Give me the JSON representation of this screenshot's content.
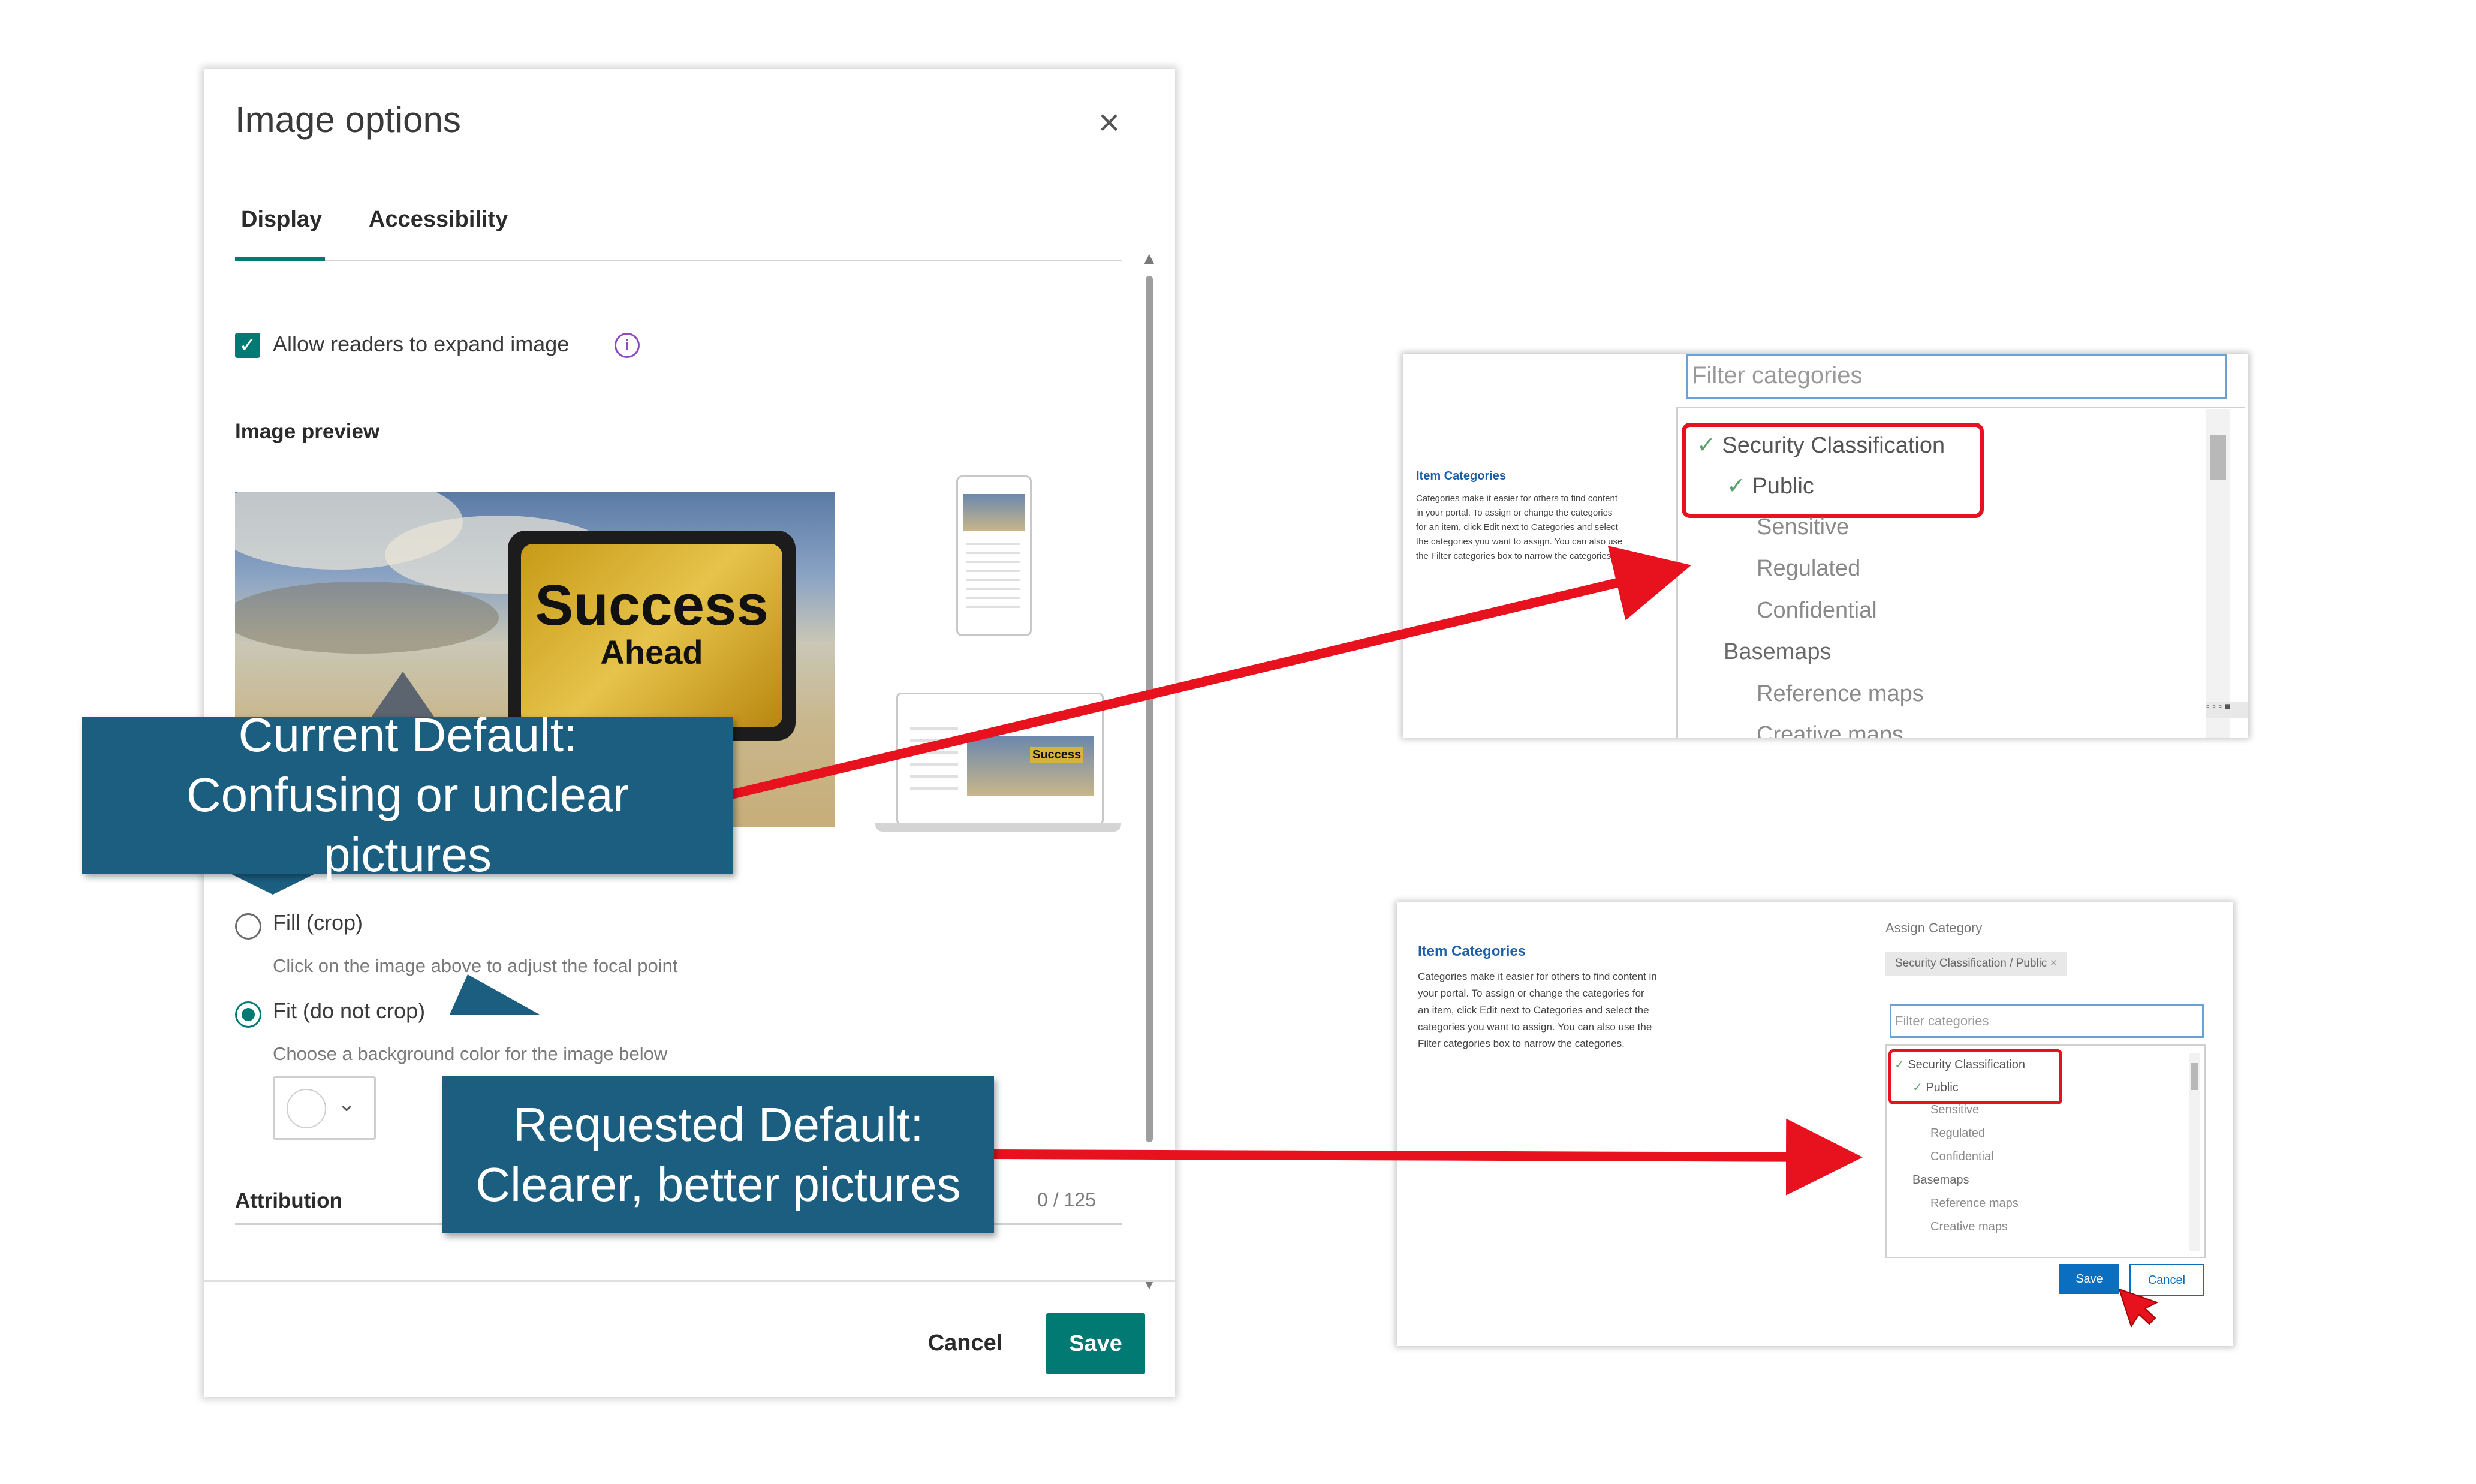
{
  "dialog": {
    "title": "Image options",
    "tabs": [
      "Display",
      "Accessibility"
    ],
    "allow_expand_label": "Allow readers to expand image",
    "image_preview_label": "Image preview",
    "preview_text_1": "Success",
    "preview_text_2": "Ahead",
    "thumb_text": "Success",
    "fill_label": "Fill (crop)",
    "fill_hint": "Click on the image above to adjust the focal point",
    "fit_label": "Fit (do not crop)",
    "fit_hint": "Choose a background color for the image below",
    "attribution_label": "Attribution",
    "attribution_count": "0 / 125",
    "cancel_label": "Cancel",
    "save_label": "Save",
    "accent_color": "#007a73"
  },
  "callouts": {
    "current": "Current Default: Confusing or unclear pictures",
    "requested": "Requested Default: Clearer, better pictures",
    "color": "#1b5e80"
  },
  "top_panel": {
    "filter_placeholder": "Filter categories",
    "item_categories_title": "Item Categories",
    "item_categories_desc": "Categories make it easier for others to find content in your portal. To assign or change the categories for an item, click Edit next to Categories and select the categories you want to assign. You can also use the Filter categories box to narrow the categories.",
    "categories": [
      {
        "label": "Security Classification",
        "checked": true
      },
      {
        "label": "Public",
        "checked": true
      },
      {
        "label": "Sensitive",
        "checked": false
      },
      {
        "label": "Regulated",
        "checked": false
      },
      {
        "label": "Confidential",
        "checked": false
      },
      {
        "label": "Basemaps",
        "checked": false
      },
      {
        "label": "Reference maps",
        "checked": false
      },
      {
        "label": "Creative maps",
        "checked": false
      }
    ]
  },
  "bottom_panel": {
    "item_categories_title": "Item Categories",
    "item_categories_desc": "Categories make it easier for others to find content in your portal. To assign or change the categories for an item, click Edit next to Categories and select the categories you want to assign. You can also use the Filter categories box to narrow the categories.",
    "assign_label": "Assign Category",
    "chip_label": "Security Classification / Public",
    "filter_placeholder": "Filter categories",
    "categories": [
      {
        "label": "Security Classification",
        "checked": true
      },
      {
        "label": "Public",
        "checked": true
      },
      {
        "label": "Sensitive",
        "checked": false
      },
      {
        "label": "Regulated",
        "checked": false
      },
      {
        "label": "Confidential",
        "checked": false
      },
      {
        "label": "Basemaps",
        "checked": false
      },
      {
        "label": "Reference maps",
        "checked": false
      },
      {
        "label": "Creative maps",
        "checked": false
      }
    ],
    "save_label": "Save",
    "cancel_label": "Cancel"
  },
  "annotation_color": "#e8121e"
}
